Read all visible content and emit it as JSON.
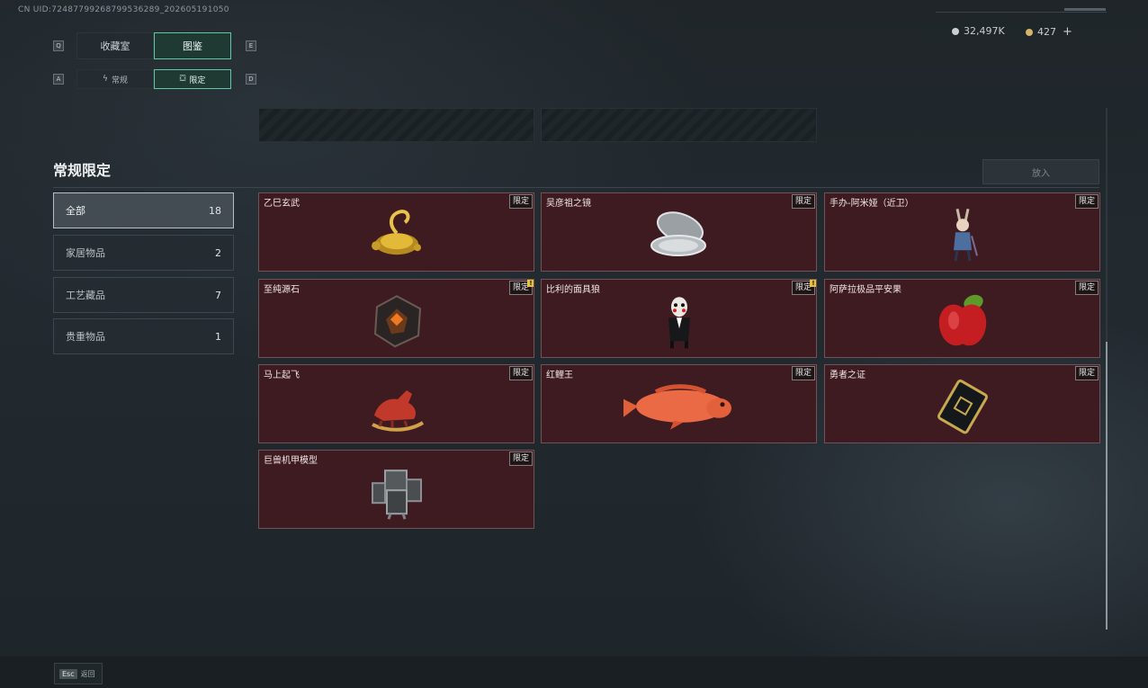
{
  "uid": "CN UID:7248779926879953628​9_202605191050",
  "tabs": {
    "key_left": "Q",
    "key_right": "E",
    "items": [
      {
        "label": "收藏室",
        "active": false
      },
      {
        "label": "图鉴",
        "active": true
      }
    ]
  },
  "subtabs": {
    "key_left": "A",
    "key_right": "D",
    "items": [
      {
        "label": "常规",
        "icon": "lightning-icon",
        "active": false
      },
      {
        "label": "限定",
        "icon": "limited-icon",
        "active": true
      }
    ]
  },
  "currency": [
    {
      "value": "32,497K",
      "icon": "silver-coin-icon",
      "color": "#c9ced2"
    },
    {
      "value": "427",
      "icon": "gold-coin-icon",
      "color": "#d4b36a",
      "add": "+"
    }
  ],
  "section": {
    "title": "常规限定",
    "sort_button": "放入"
  },
  "categories": [
    {
      "label": "全部",
      "count": "18",
      "active": true
    },
    {
      "label": "家居物品",
      "count": "2",
      "active": false
    },
    {
      "label": "工艺藏品",
      "count": "7",
      "active": false
    },
    {
      "label": "贵重物品",
      "count": "1",
      "active": false
    }
  ],
  "badge_text": "限定",
  "items": [
    {
      "name": "乙巳玄武",
      "icon": "golden-turtle-icon",
      "warn": false
    },
    {
      "name": "吴彦祖之镜",
      "icon": "compact-mirror-icon",
      "warn": false
    },
    {
      "name": "手办-阿米娅（近卫）",
      "icon": "figure-amiya-icon",
      "warn": false
    },
    {
      "name": "至纯源石",
      "icon": "originium-crystal-icon",
      "warn": true
    },
    {
      "name": "比利的面具狼",
      "icon": "billy-puppet-icon",
      "warn": true
    },
    {
      "name": "阿萨拉极品平安果",
      "icon": "red-apple-icon",
      "warn": false
    },
    {
      "name": "马上起飞",
      "icon": "red-horse-icon",
      "warn": false
    },
    {
      "name": "红鲤王",
      "icon": "red-carp-icon",
      "warn": false
    },
    {
      "name": "勇者之证",
      "icon": "hero-card-icon",
      "warn": false
    },
    {
      "name": "巨兽机甲模型",
      "icon": "mech-model-icon",
      "warn": false
    }
  ],
  "footer": {
    "esc_key": "Esc",
    "esc_label": "返回"
  }
}
